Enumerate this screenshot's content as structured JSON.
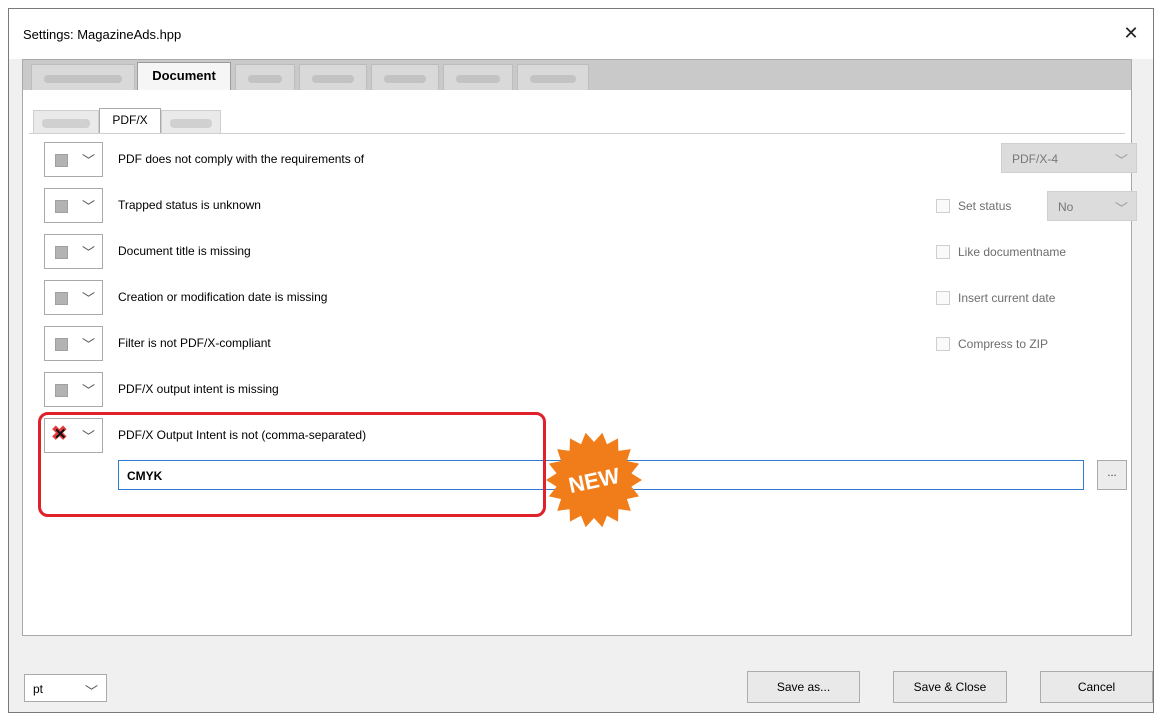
{
  "window": {
    "title": "Settings: MagazineAds.hpp"
  },
  "outer_tabs": {
    "active_label": "Document"
  },
  "inner_tabs": {
    "active_label": "PDF/X"
  },
  "rows": [
    {
      "label": "PDF does not comply with the requirements of",
      "state": "unchecked"
    },
    {
      "label": "Trapped status is unknown",
      "state": "unchecked"
    },
    {
      "label": "Document title is missing",
      "state": "unchecked"
    },
    {
      "label": "Creation or modification date is missing",
      "state": "unchecked"
    },
    {
      "label": "Filter is not PDF/X-compliant",
      "state": "unchecked"
    },
    {
      "label": "PDF/X output intent is missing",
      "state": "unchecked"
    },
    {
      "label": "PDF/X Output Intent is not (comma-separated)",
      "state": "error"
    }
  ],
  "options": {
    "pdfx_select": "PDF/X-4",
    "set_status_label": "Set status",
    "status_select": "No",
    "like_documentname_label": "Like documentname",
    "insert_date_label": "Insert current date",
    "compress_zip_label": "Compress to ZIP"
  },
  "intent_input": {
    "value": "CMYK"
  },
  "ellipsis_button": "...",
  "badge": {
    "text": "NEW",
    "color": "#f07d1a"
  },
  "highlight_color": "#e0202a",
  "footer": {
    "unit_select": "pt",
    "save_as": "Save as...",
    "save_close": "Save & Close",
    "cancel": "Cancel"
  }
}
